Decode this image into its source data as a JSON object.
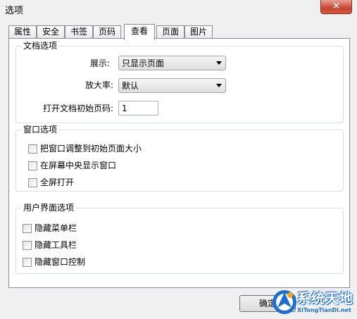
{
  "window": {
    "title": "选项",
    "close_glyph": "✕"
  },
  "tabs": [
    {
      "label": "属性"
    },
    {
      "label": "安全"
    },
    {
      "label": "书签"
    },
    {
      "label": "页码"
    },
    {
      "label": "查看",
      "active": true
    },
    {
      "label": "页面"
    },
    {
      "label": "图片"
    }
  ],
  "doc_options": {
    "title": "文档选项",
    "display_label": "展示:",
    "display_value": "只显示页面",
    "zoom_label": "放大率:",
    "zoom_value": "默认",
    "open_page_label": "打开文档初始页码:",
    "open_page_value": "1"
  },
  "window_options": {
    "title": "窗口选项",
    "items": [
      {
        "label": "把窗口调整到初始页面大小",
        "checked": false
      },
      {
        "label": "在屏幕中央显示窗口",
        "checked": false
      },
      {
        "label": "全屏打开",
        "checked": false
      }
    ]
  },
  "ui_options": {
    "title": "用户界面选项",
    "items": [
      {
        "label": "隐藏菜单栏",
        "checked": false
      },
      {
        "label": "隐藏工具栏",
        "checked": false
      },
      {
        "label": "隐藏窗口控制",
        "checked": false
      }
    ]
  },
  "buttons": {
    "ok": "确定"
  },
  "watermark": {
    "title": "系统天地",
    "subtitle": "XiTongTianDi.net"
  }
}
